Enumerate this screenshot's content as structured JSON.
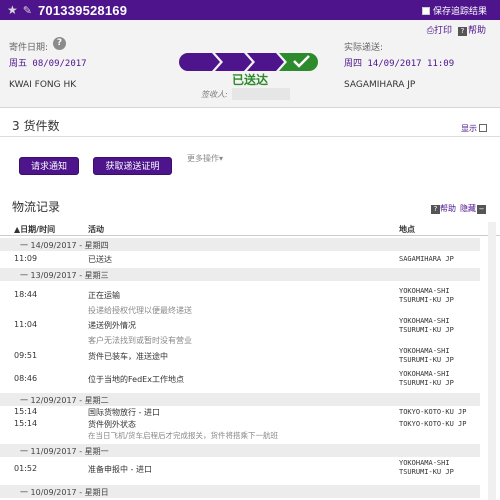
{
  "header": {
    "tracking_number": "701339528169",
    "save_label": "保存追踪结果"
  },
  "summary": {
    "print_label": "打印",
    "help_label": "帮助",
    "ship_date_label": "寄件日期:",
    "ship_date": "周五 08/09/2017",
    "origin": "KWAI FONG HK",
    "status": "已送达",
    "signed_by_label": "签收人:",
    "delivery_label": "实际递送:",
    "delivery_date": "周四 14/09/2017 11:09",
    "destination": "SAGAMIHARA JP"
  },
  "pieces": {
    "title": "3 货件数",
    "show_label": "显示"
  },
  "actions": {
    "request_notification": "请求通知",
    "get_proof": "获取递送证明",
    "more": "更多操作▾"
  },
  "history": {
    "title": "物流记录",
    "help_label": "帮助",
    "hide_label": "隐藏",
    "col_date": "▲日期/时间",
    "col_activity": "活动",
    "col_location": "地点",
    "days": [
      {
        "label": "一  14/09/2017 - 星期四"
      },
      {
        "label": "一  13/09/2017 - 星期三"
      },
      {
        "label": "一  12/09/2017 - 星期二"
      },
      {
        "label": "一  11/09/2017 - 星期一"
      },
      {
        "label": "一  10/09/2017 - 星期日"
      }
    ],
    "events": [
      {
        "time": "11:09",
        "activity": "已送达",
        "sub": "",
        "loc1": "SAGAMIHARA JP",
        "loc2": ""
      },
      {
        "time": "18:44",
        "activity": "正在运输",
        "sub": "投递给授权代理以便最终递送",
        "loc1": "YOKOHAMA-SHI",
        "loc2": "TSURUMI-KU JP"
      },
      {
        "time": "11:04",
        "activity": "递送例外情况",
        "sub": "客户无法找到或暂时没有营业",
        "loc1": "YOKOHAMA-SHI",
        "loc2": "TSURUMI-KU JP"
      },
      {
        "time": "09:51",
        "activity": "货件已装车，准送途中",
        "sub": "",
        "loc1": "YOKOHAMA-SHI",
        "loc2": "TSURUMI-KU JP"
      },
      {
        "time": "08:46",
        "activity": "位于当地的FedEx工作地点",
        "sub": "",
        "loc1": "YOKOHAMA-SHI",
        "loc2": "TSURUMI-KU JP"
      },
      {
        "time": "15:14",
        "activity": "国际货物放行 - 进口",
        "sub": "",
        "loc1": "TOKYO-KOTO-KU JP",
        "loc2": ""
      },
      {
        "time": "15:14",
        "activity": "货件例外状态",
        "sub": "在当日飞机/货车启程后才完成报关，货件将搭乘下一航班",
        "loc1": "TOKYO-KOTO-KU JP",
        "loc2": ""
      },
      {
        "time": "01:52",
        "activity": "准备申报中 - 进口",
        "sub": "",
        "loc1": "YOKOHAMA-SHI",
        "loc2": "TSURUMI-KU JP"
      }
    ]
  },
  "colors": {
    "brand_purple": "#4d148c",
    "delivered_green": "#2d8a2d"
  }
}
